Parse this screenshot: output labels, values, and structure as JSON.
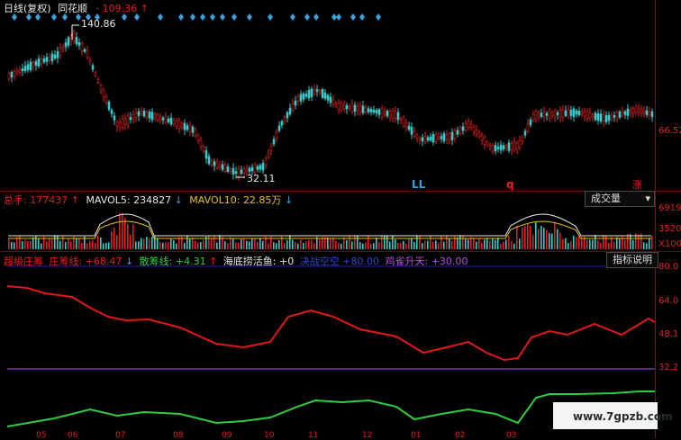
{
  "price_panel": {
    "title": "日线(复权)",
    "source": "同花顺",
    "price": "109.36",
    "price_arrow": "↑",
    "high_label": "140.86",
    "low_label": "32.11",
    "axis_label": "66.52",
    "markers": [
      "LL",
      "q",
      "涨"
    ]
  },
  "volume_panel": {
    "total_label": "总手:",
    "total_value": "177437",
    "total_arrow": "↑",
    "mavol5_label": "MAVOL5:",
    "mavol5_value": "234827",
    "mavol5_arrow": "↓",
    "mavol10_label": "MAVOL10:",
    "mavol10_value": "22.85万",
    "mavol10_arrow": "↓",
    "dropdown": "成交量",
    "axis_labels": [
      "6919",
      "3520",
      "X100"
    ]
  },
  "indicator_panel": {
    "name": "超级庄筹",
    "zhuang_label": "庄筹线:",
    "zhuang_value": "+68.47",
    "zhuang_arrow": "↓",
    "san_label": "散筹线:",
    "san_value": "+4.31",
    "san_arrow": "↑",
    "hai_label": "海底捞活鱼:",
    "hai_value": "+0",
    "jue_label": "决战空空",
    "jue_value": "+80.00",
    "ji_label": "鸡雀升天:",
    "ji_value": "+30.00",
    "help_button": "指标说明",
    "axis_labels": [
      "80.0",
      "64.0",
      "48.1",
      "32.2"
    ]
  },
  "x_axis": [
    "05",
    "06",
    "07",
    "08",
    "09",
    "10",
    "11",
    "12",
    "01",
    "02",
    "03"
  ],
  "watermark": "www.7gpzb.com",
  "colors": {
    "red": "#e02020",
    "green": "#2ecc40",
    "cyan": "#3aa0e0",
    "purple": "#b050e0",
    "yellow": "#e8c020",
    "bg": "#000000"
  }
}
